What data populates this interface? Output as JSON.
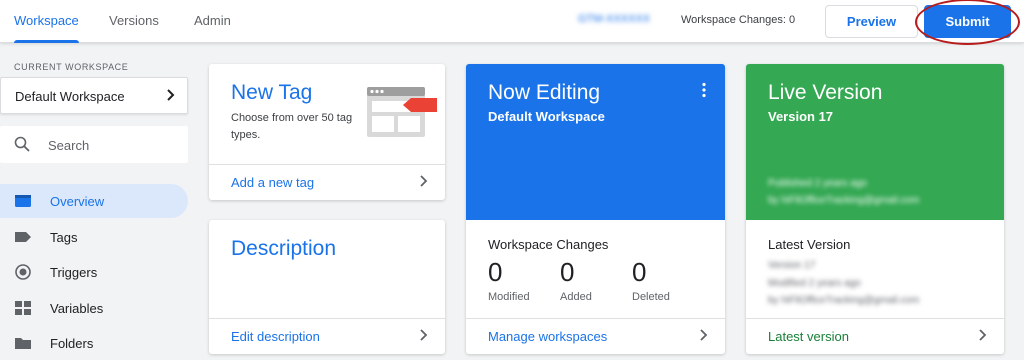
{
  "topbar": {
    "tabs": [
      {
        "label": "Workspace",
        "active": true
      },
      {
        "label": "Versions",
        "active": false
      },
      {
        "label": "Admin",
        "active": false
      }
    ],
    "container_id": "GTM-XXXXXX",
    "workspace_changes": "Workspace Changes: 0",
    "preview_label": "Preview",
    "submit_label": "Submit"
  },
  "sidebar": {
    "current_workspace_label": "CURRENT WORKSPACE",
    "workspace_name": "Default Workspace",
    "search_placeholder": "Search",
    "items": [
      {
        "label": "Overview",
        "active": true,
        "icon": "overview-icon"
      },
      {
        "label": "Tags",
        "icon": "tag-icon"
      },
      {
        "label": "Triggers",
        "icon": "trigger-icon"
      },
      {
        "label": "Variables",
        "icon": "variable-icon"
      },
      {
        "label": "Folders",
        "icon": "folder-icon"
      }
    ]
  },
  "cards": {
    "new_tag": {
      "title": "New Tag",
      "description": "Choose from over 50 tag types.",
      "link": "Add a new tag"
    },
    "description": {
      "title": "Description",
      "link": "Edit description"
    },
    "now_editing": {
      "title": "Now Editing",
      "subtitle": "Default Workspace",
      "changes_title": "Workspace Changes",
      "stats": [
        {
          "value": "0",
          "label": "Modified"
        },
        {
          "value": "0",
          "label": "Added"
        },
        {
          "value": "0",
          "label": "Deleted"
        }
      ],
      "link": "Manage workspaces"
    },
    "live_version": {
      "title": "Live Version",
      "subtitle": "Version 17",
      "blurred_line1": "Published 2 years ago",
      "blurred_line2": "by hiFliOfficeTracking@gmail.com",
      "latest_title": "Latest Version",
      "latest_blur1": "Version 17",
      "latest_blur2": "Modified 2 years ago",
      "latest_blur3": "by hiFliOfficeTracking@gmail.com",
      "link": "Latest version"
    }
  },
  "colors": {
    "accent": "#1a73e8",
    "live_green": "#34a853",
    "submit_ring": "#b71c1c"
  }
}
